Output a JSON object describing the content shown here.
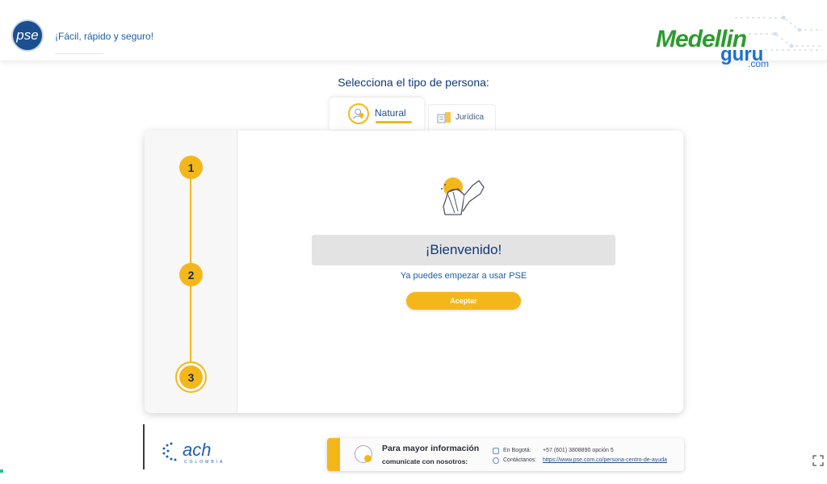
{
  "header": {
    "logo_text": "pse",
    "tagline": "¡Fácil, rápido y seguro!",
    "brand_medellin": "Medellin",
    "brand_guru": "guru",
    "brand_com": ".com"
  },
  "person_type": {
    "title": "Selecciona el tipo de persona:",
    "tabs": [
      {
        "label": "Natural",
        "selected": true
      },
      {
        "label": "Jurídica",
        "selected": false
      }
    ]
  },
  "stepper": {
    "steps": [
      "1",
      "2",
      "3"
    ],
    "current": 3
  },
  "welcome": {
    "heading": "¡Bienvenido!",
    "message": "Ya puedes empezar a usar PSE",
    "accept_label": "Aceptar"
  },
  "footer": {
    "ach_logo": "ach",
    "ach_sub": "COLOMBIA",
    "info_title": "Para mayor información",
    "info_subtitle": "comunícate con nosotros:",
    "contacts": [
      {
        "label": "En Bogotá:",
        "value": "+57 (601) 3808890 opción 5",
        "icon": "phone-icon"
      },
      {
        "label": "Contáctanos:",
        "value": "https://www.pse.com.co/persona-centro-de-ayuda",
        "icon": "whatsapp-icon"
      }
    ]
  },
  "colors": {
    "accent": "#f4b71b",
    "primary": "#0d3a78",
    "brand_green": "#2d9b2f",
    "brand_blue": "#1c6fd1"
  }
}
